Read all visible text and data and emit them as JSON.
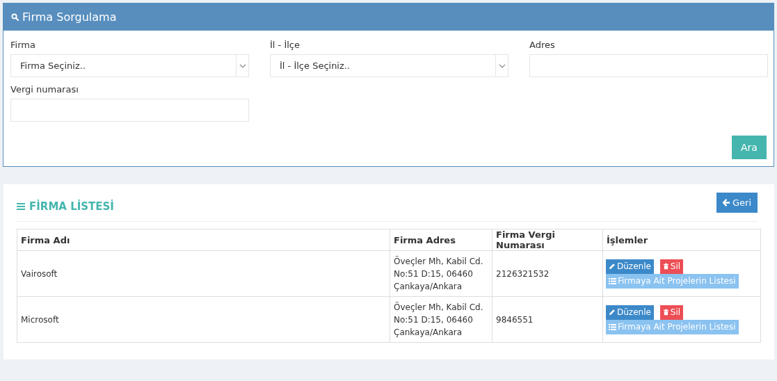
{
  "search_panel": {
    "title": "Firma Sorgulama",
    "fields": [
      {
        "kind": "select",
        "label": "Firma",
        "placeholder": "Firma Seçiniz.."
      },
      {
        "kind": "select",
        "label": "İl - İlçe",
        "placeholder": "İl - İlçe Seçiniz.."
      },
      {
        "kind": "input",
        "label": "Adres"
      },
      {
        "kind": "input",
        "label": "Vergi numarası"
      }
    ],
    "search_button": "Ara"
  },
  "list_panel": {
    "title": "FİRMA LİSTESİ",
    "back_button": "Geri",
    "table": {
      "columns": [
        "Firma Adı",
        "Firma Adres",
        "Firma Vergi Numarası",
        "İşlemler"
      ],
      "rows": [
        {
          "name": "Vairosoft",
          "address": "Öveçler Mh, Kabil Cd. No:51 D:15, 06460 Çankaya/Ankara",
          "tax_number": "2126321532",
          "actions": [
            {
              "kind": "edit",
              "label": "Düzenle"
            },
            {
              "kind": "delete",
              "label": "Sil"
            },
            {
              "kind": "list",
              "label": "Firmaya Ait Projelerin Listesi"
            }
          ]
        },
        {
          "name": "Microsoft",
          "address": "Öveçler Mh, Kabil Cd. No:51 D:15, 06460 Çankaya/Ankara",
          "tax_number": "9846551",
          "actions": [
            {
              "kind": "edit",
              "label": "Düzenle"
            },
            {
              "kind": "delete",
              "label": "Sil"
            },
            {
              "kind": "list",
              "label": "Firmaya Ait Projelerin Listesi"
            }
          ]
        }
      ]
    }
  }
}
